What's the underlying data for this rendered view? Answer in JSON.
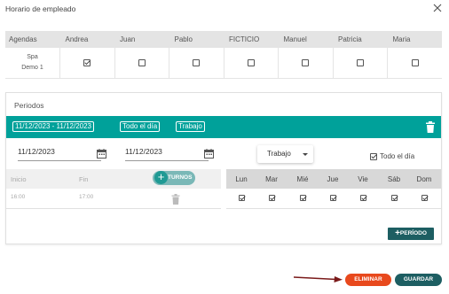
{
  "dialog": {
    "title": "Horario de empleado"
  },
  "employees": {
    "header_label": "Agendas",
    "columns": [
      "Andrea",
      "Juan",
      "Pablo",
      "FICTICIO",
      "Manuel",
      "Patricia",
      "Maria"
    ],
    "rows": [
      {
        "label_line1": "Spa",
        "label_line2": "Demo 1",
        "checked": [
          true,
          false,
          false,
          false,
          false,
          false,
          false
        ]
      }
    ]
  },
  "periodos": {
    "title": "Periodos",
    "period": {
      "range_chip": "11/12/2023 - 11/12/2023",
      "allday_chip": "Todo el día",
      "type_chip": "Trabajo",
      "start_date": "11/12/2023",
      "end_date": "11/12/2023",
      "type_select": "Trabajo",
      "allday_label": "Todo el día",
      "allday_checked": true
    },
    "shifts": {
      "start_header": "Inicio",
      "end_header": "Fin",
      "add_button": "TURNOS",
      "rows": [
        {
          "start": "16:00",
          "end": "17:00"
        }
      ]
    },
    "days": {
      "labels": [
        "Lun",
        "Mar",
        "Mié",
        "Jue",
        "Vie",
        "Sáb",
        "Dom"
      ],
      "checked": [
        true,
        true,
        true,
        true,
        true,
        true,
        true
      ]
    },
    "add_period_button": "PERÍODO"
  },
  "footer": {
    "delete_button": "ELIMINAR",
    "save_button": "GUARDAR"
  },
  "colors": {
    "teal": "#00a19a",
    "dark_teal": "#1d5e62",
    "orange": "#e8491d",
    "arrow": "#7a1a1a"
  },
  "icons": [
    "close-icon",
    "trash-icon",
    "calendar-icon",
    "plus-icon",
    "arrow-icon"
  ]
}
